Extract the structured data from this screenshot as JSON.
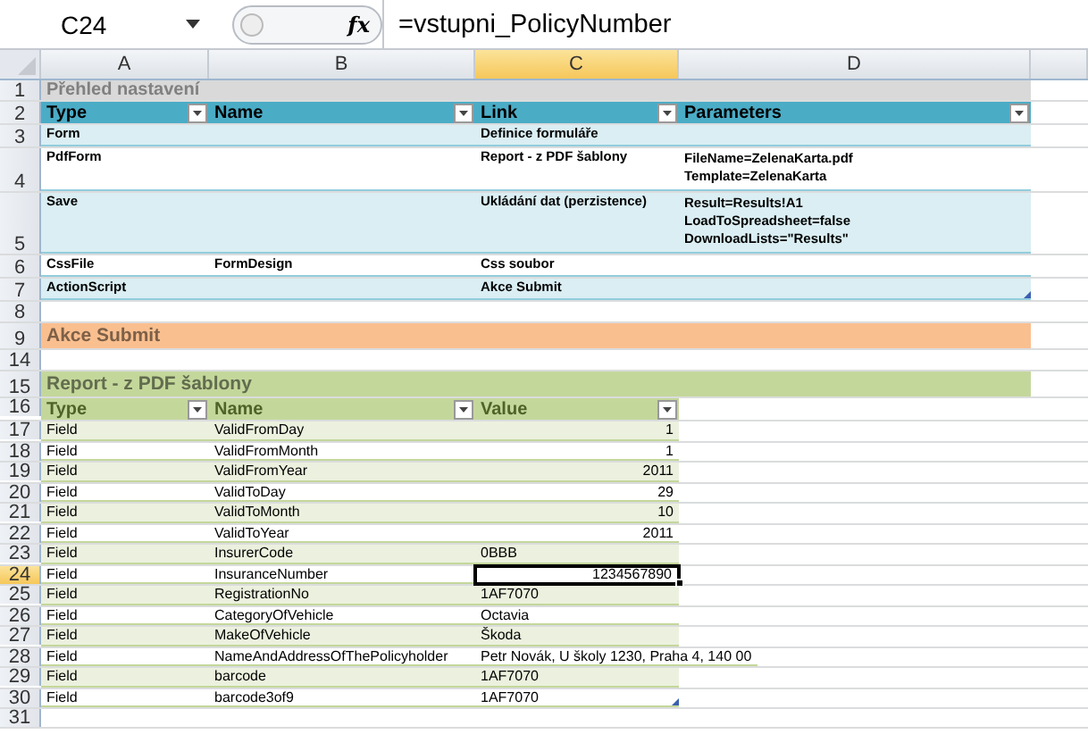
{
  "name_box": "C24",
  "fx_label": "fx",
  "formula": "=vstupni_PolicyNumber",
  "columns": [
    {
      "label": "A",
      "selected": false
    },
    {
      "label": "B",
      "selected": false
    },
    {
      "label": "C",
      "selected": true
    },
    {
      "label": "D",
      "selected": false
    }
  ],
  "blocks": [
    {
      "kind": "title",
      "num": "1",
      "text": "Přehled nastavení"
    },
    {
      "kind": "settings",
      "header": {
        "num": "2",
        "cells": [
          "Type",
          "Name",
          "Link",
          "Parameters"
        ]
      },
      "rows": [
        {
          "num": "3",
          "cells": [
            "Form",
            null,
            "Definice formuláře",
            null
          ]
        },
        {
          "num": "4",
          "cells": [
            "PdfForm",
            null,
            "Report - z PDF šablony",
            {
              "lines": [
                "FileName=ZelenaKarta.pdf",
                "Template=ZelenaKarta"
              ]
            }
          ]
        },
        {
          "num": "5",
          "cells": [
            "Save",
            null,
            "Ukládání dat (perzistence)",
            {
              "lines": [
                "Result=Results!A1",
                "LoadToSpreadsheet=false",
                "DownloadLists=\"Results\""
              ]
            }
          ]
        },
        {
          "num": "6",
          "cells": [
            "CssFile",
            "FormDesign",
            "Css soubor",
            null
          ]
        },
        {
          "num": "7",
          "cells": [
            "ActionScript",
            null,
            "Akce Submit",
            null
          ]
        }
      ]
    },
    {
      "kind": "gap",
      "num": "8"
    },
    {
      "kind": "section",
      "num": "9",
      "color": "#fabf8f",
      "text": "Akce Submit"
    },
    {
      "kind": "gap",
      "num": "14"
    },
    {
      "kind": "section",
      "num": "15",
      "color": "#c4d79b",
      "text": "Report - z PDF šablony"
    },
    {
      "kind": "fields",
      "header": {
        "num": "16",
        "cells": [
          "Type",
          "Name",
          "Value"
        ]
      },
      "rows": [
        {
          "num": "17",
          "cells": [
            "Field",
            "ValidFromDay",
            {
              "text": "1",
              "numeric": true
            }
          ]
        },
        {
          "num": "18",
          "cells": [
            "Field",
            "ValidFromMonth",
            {
              "text": "1",
              "numeric": true
            }
          ]
        },
        {
          "num": "19",
          "cells": [
            "Field",
            "ValidFromYear",
            {
              "text": "2011",
              "numeric": true
            }
          ]
        },
        {
          "num": "20",
          "cells": [
            "Field",
            "ValidToDay",
            {
              "text": "29",
              "numeric": true
            }
          ]
        },
        {
          "num": "21",
          "cells": [
            "Field",
            "ValidToMonth",
            {
              "text": "10",
              "numeric": true
            }
          ]
        },
        {
          "num": "22",
          "cells": [
            "Field",
            "ValidToYear",
            {
              "text": "2011",
              "numeric": true
            }
          ]
        },
        {
          "num": "23",
          "cells": [
            "Field",
            "InsurerCode",
            "0BBB"
          ]
        },
        {
          "num": "24",
          "selected": true,
          "cells": [
            "Field",
            "InsuranceNumber",
            {
              "text": "1234567890",
              "numeric": true,
              "selected": true
            }
          ]
        },
        {
          "num": "25",
          "cells": [
            "Field",
            "RegistrationNo",
            "1AF7070"
          ]
        },
        {
          "num": "26",
          "cells": [
            "Field",
            "CategoryOfVehicle",
            "Octavia"
          ]
        },
        {
          "num": "27",
          "cells": [
            "Field",
            "MakeOfVehicle",
            "Škoda"
          ]
        },
        {
          "num": "28",
          "cells": [
            "Field",
            "NameAndAddressOfThePolicyholder",
            "Petr Novák, U školy 1230, Praha 4, 140 00"
          ]
        },
        {
          "num": "29",
          "cells": [
            "Field",
            "barcode",
            "1AF7070"
          ]
        },
        {
          "num": "30",
          "cells": [
            "Field",
            "barcode3of9",
            "1AF7070"
          ]
        }
      ]
    },
    {
      "kind": "gap",
      "num": "31"
    }
  ]
}
